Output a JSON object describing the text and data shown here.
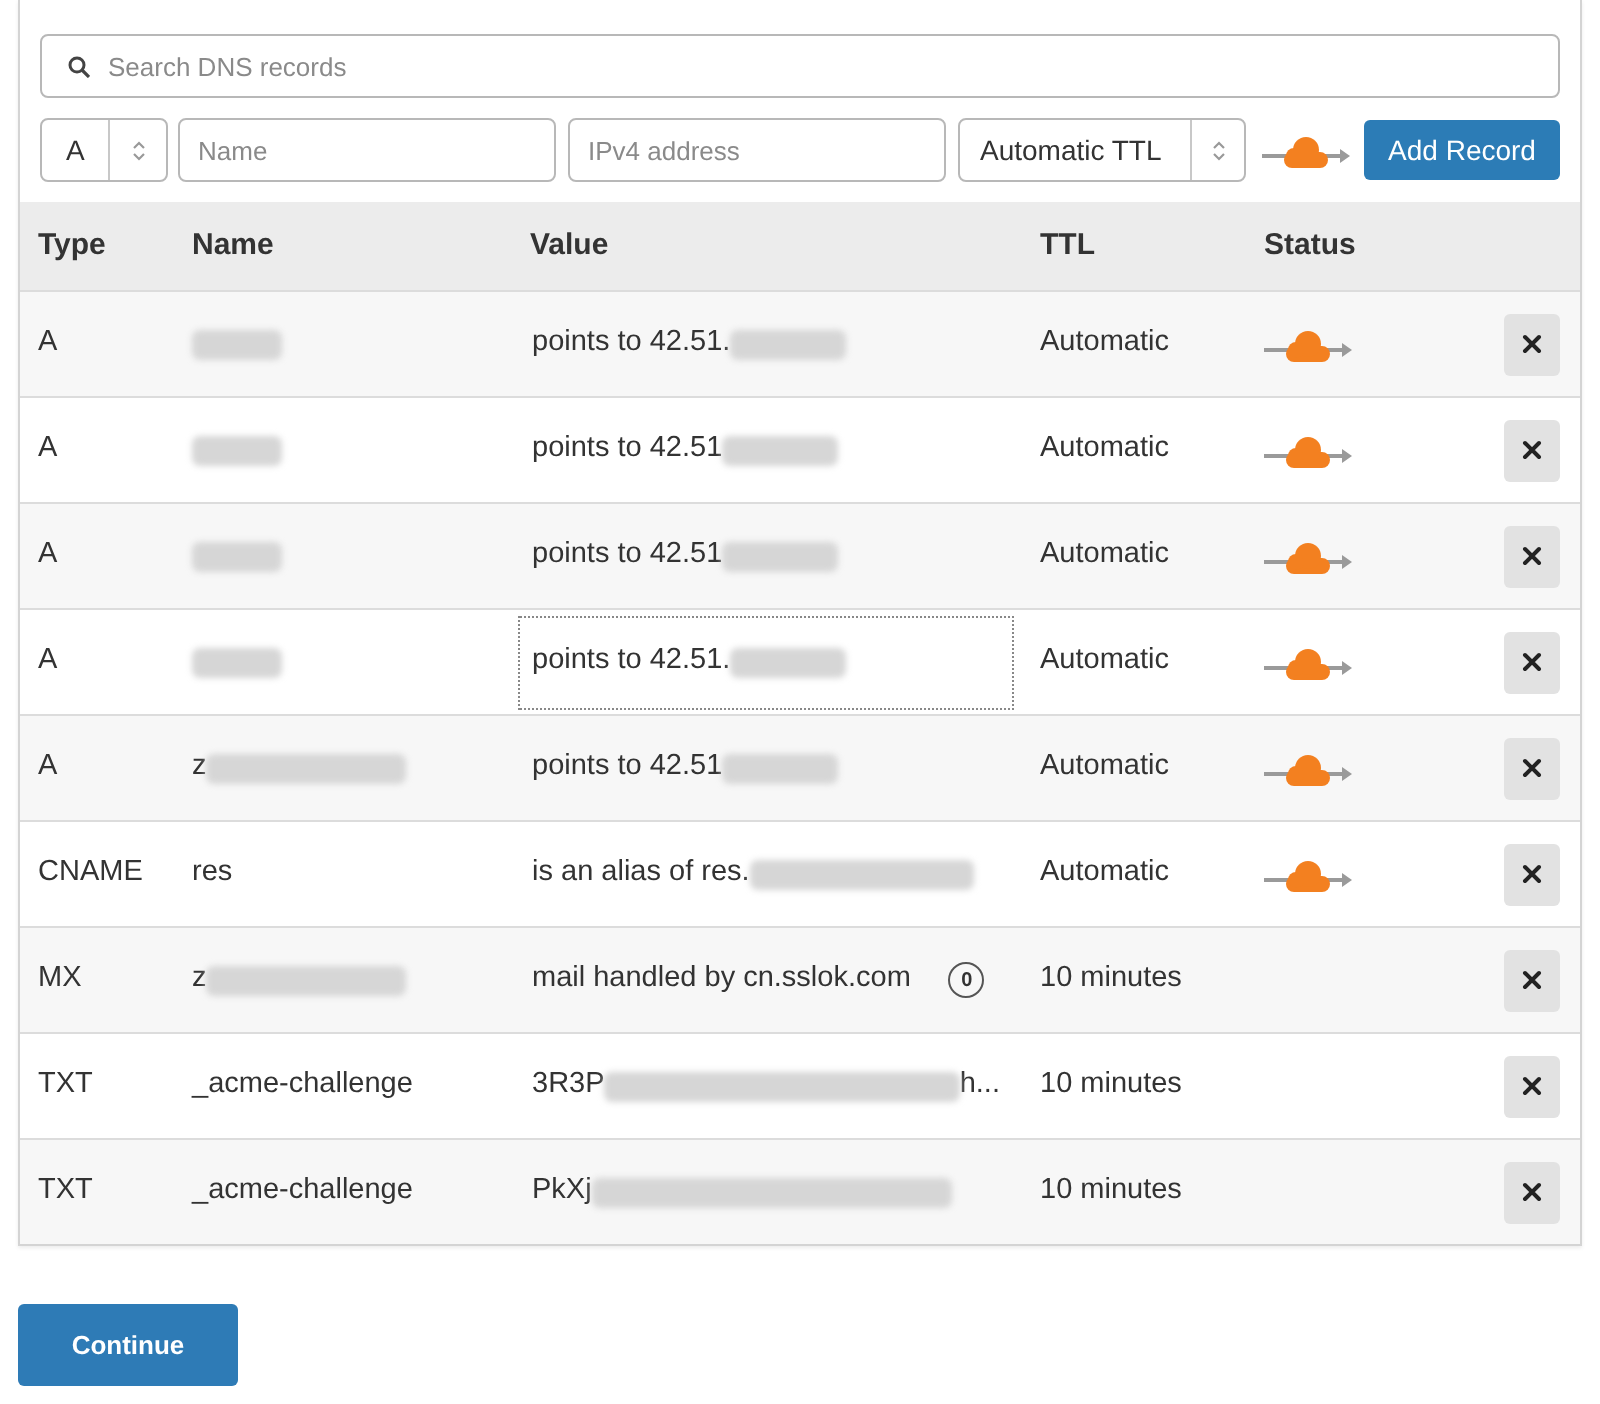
{
  "search": {
    "placeholder": "Search DNS records"
  },
  "new_record": {
    "type": "A",
    "name_placeholder": "Name",
    "value_placeholder": "IPv4 address",
    "ttl": "Automatic TTL",
    "proxied": true,
    "button": "Add Record"
  },
  "table": {
    "columns": [
      "Type",
      "Name",
      "Value",
      "TTL",
      "Status"
    ],
    "rows": [
      {
        "type": "A",
        "name_redacted": true,
        "value": "points to 42.51.",
        "value_redacted": true,
        "value_focused": false,
        "ttl": "Automatic",
        "proxied": true
      },
      {
        "type": "A",
        "name_redacted": true,
        "value": "points to 42.51",
        "value_redacted": true,
        "value_focused": false,
        "ttl": "Automatic",
        "proxied": true
      },
      {
        "type": "A",
        "name_redacted": true,
        "value": "points to 42.51",
        "value_redacted": true,
        "value_focused": false,
        "ttl": "Automatic",
        "proxied": true
      },
      {
        "type": "A",
        "name_redacted": true,
        "value": "points to 42.51.",
        "value_redacted": true,
        "value_focused": true,
        "ttl": "Automatic",
        "proxied": true
      },
      {
        "type": "A",
        "name": "z",
        "name_redacted": true,
        "value": "points to 42.51",
        "value_redacted": true,
        "value_focused": false,
        "ttl": "Automatic",
        "proxied": true
      },
      {
        "type": "CNAME",
        "name": "res",
        "name_redacted": false,
        "value": "is an alias of res.",
        "value_redacted": true,
        "value_focused": false,
        "ttl": "Automatic",
        "proxied": true
      },
      {
        "type": "MX",
        "name": "z",
        "name_redacted": true,
        "value": "mail handled by cn.sslok.com",
        "value_redacted": false,
        "priority": "0",
        "value_focused": false,
        "ttl": "10 minutes",
        "proxied": false
      },
      {
        "type": "TXT",
        "name": "_acme-challenge",
        "name_redacted": false,
        "value": "3R3P",
        "value_redacted": true,
        "value_suffix": "h...",
        "value_focused": false,
        "ttl": "10 minutes",
        "proxied": false
      },
      {
        "type": "TXT",
        "name": "_acme-challenge",
        "name_redacted": false,
        "value": "PkXj",
        "value_redacted": true,
        "value_focused": false,
        "ttl": "10 minutes",
        "proxied": false
      }
    ]
  },
  "continue_button": "Continue"
}
